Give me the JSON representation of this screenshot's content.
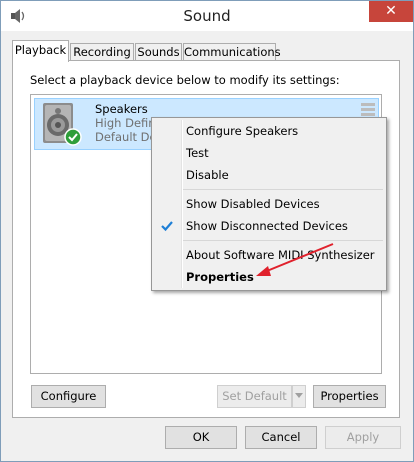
{
  "window": {
    "title": "Sound",
    "close_glyph": "✕"
  },
  "tabs": [
    {
      "label": "Playback"
    },
    {
      "label": "Recording"
    },
    {
      "label": "Sounds"
    },
    {
      "label": "Communications"
    }
  ],
  "playback": {
    "instruction": "Select a playback device below to modify its settings:",
    "device": {
      "name": "Speakers",
      "line1": "High Defin",
      "line2": "Default Dev",
      "icon": "speaker-icon",
      "status_icon": "default-check-icon"
    },
    "buttons": {
      "configure": "Configure",
      "set_default": "Set Default",
      "properties": "Properties"
    }
  },
  "context_menu": {
    "items": [
      {
        "label": "Configure Speakers"
      },
      {
        "label": "Test"
      },
      {
        "label": "Disable"
      },
      {
        "label": "Show Disabled Devices"
      },
      {
        "label": "Show Disconnected Devices",
        "checked": true
      },
      {
        "label": "About Software MIDI Synthesizer"
      },
      {
        "label": "Properties",
        "bold": true
      }
    ]
  },
  "footer": {
    "ok": "OK",
    "cancel": "Cancel",
    "apply": "Apply"
  },
  "colors": {
    "selection": "#cce8ff",
    "close": "#c7453b",
    "arrow": "#e0212c",
    "check": "#1e7fd6"
  }
}
